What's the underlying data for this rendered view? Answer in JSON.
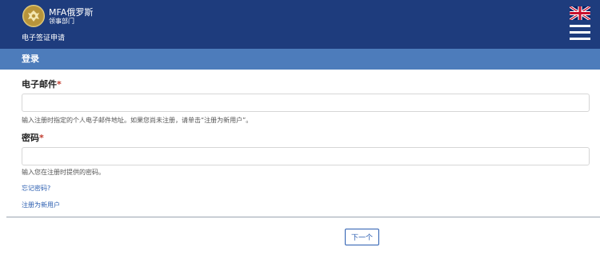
{
  "header": {
    "brand_title": "MFA俄罗斯",
    "brand_subtitle": "领事部门",
    "section_link": "电子签证申请",
    "language_flag_icon": "uk-flag-icon",
    "menu_icon": "hamburger-menu-icon",
    "background_color": "#1e3c7d"
  },
  "login_bar": {
    "title": "登录",
    "background_color": "#4d7cbb"
  },
  "form": {
    "email": {
      "label": "电子邮件",
      "required_mark": "*",
      "value": "",
      "help": "输入注册时指定的个人电子邮件地址。如果您尚未注册，请单击“注册为新用户”。"
    },
    "password": {
      "label": "密码",
      "required_mark": "*",
      "value": "",
      "help": "输入您在注册时提供的密码。"
    },
    "forgot_password_link": "忘记密码?",
    "register_link": "注册为新用户",
    "next_button": "下一个"
  }
}
